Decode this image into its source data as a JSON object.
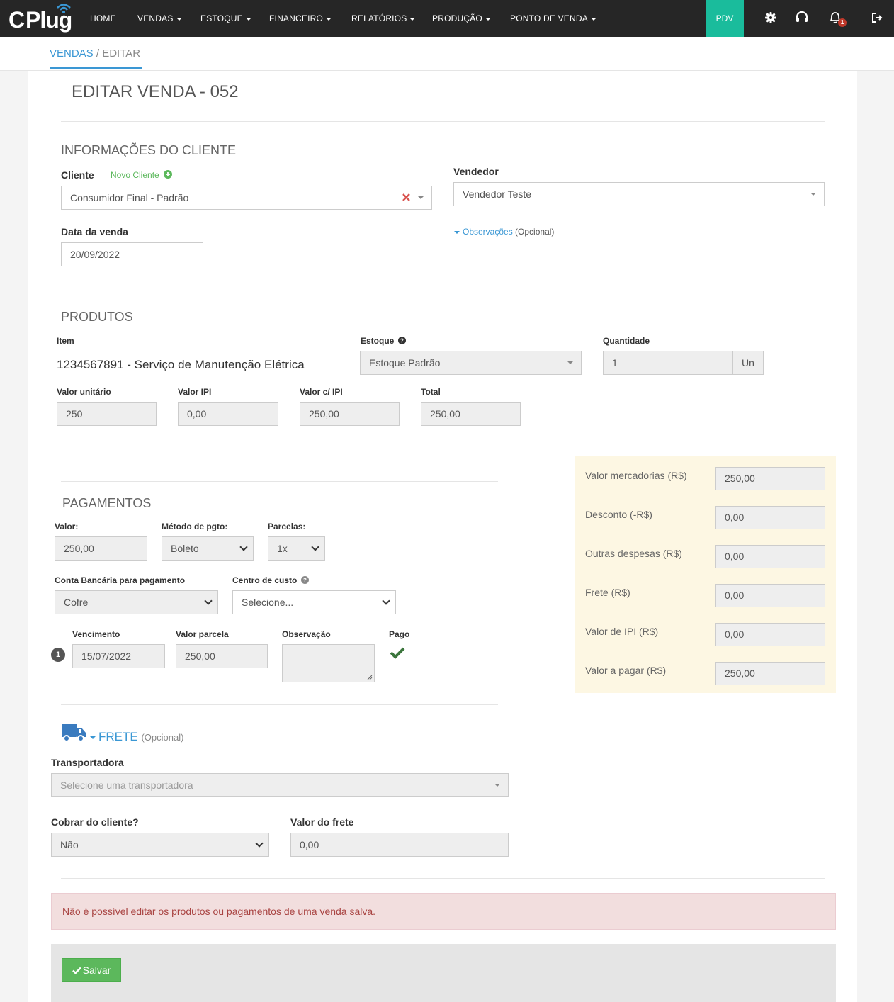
{
  "nav": {
    "logo_c": "C",
    "logo_plug": "Plug",
    "items": [
      "HOME",
      "VENDAS",
      "ESTOQUE",
      "FINANCEIRO",
      "RELATÓRIOS",
      "PRODUÇÃO",
      "PONTO DE VENDA"
    ],
    "pdv": "PDV",
    "notification_count": "1"
  },
  "breadcrumb": {
    "section": "VENDAS",
    "separator": " / ",
    "page": "EDITAR"
  },
  "page_title": "EDITAR VENDA - 052",
  "cliente_section": {
    "title": "INFORMAÇÕES DO CLIENTE",
    "cliente_label": "Cliente",
    "novo_cliente": "Novo Cliente",
    "cliente_value": "Consumidor Final - Padrão",
    "vendedor_label": "Vendedor",
    "vendedor_value": "Vendedor Teste",
    "data_label": "Data da venda",
    "data_value": "20/09/2022",
    "observacoes_link": "Observações",
    "observacoes_opcional": "(Opcional)"
  },
  "produtos": {
    "title": "PRODUTOS",
    "item_label": "Item",
    "item_value": "1234567891 - Serviço de Manutenção Elétrica",
    "estoque_label": "Estoque",
    "estoque_value": "Estoque Padrão",
    "quantidade_label": "Quantidade",
    "quantidade_value": "1",
    "unidade": "Un",
    "valor_unitario_label": "Valor unitário",
    "valor_unitario": "250",
    "valor_ipi_label": "Valor IPI",
    "valor_ipi": "0,00",
    "valor_com_ipi_label": "Valor c/ IPI",
    "valor_com_ipi": "250,00",
    "total_label": "Total",
    "total": "250,00"
  },
  "pagamentos": {
    "title": "PAGAMENTOS",
    "valor_label": "Valor:",
    "valor": "250,00",
    "metodo_label": "Método de pgto:",
    "metodo": "Boleto",
    "parcelas_label": "Parcelas:",
    "parcelas": "1x",
    "conta_label": "Conta Bancária para pagamento",
    "conta": "Cofre",
    "centro_label": "Centro de custo",
    "centro": "Selecione...",
    "vencimento_label": "Vencimento",
    "valor_parcela_label": "Valor parcela",
    "observacao_label": "Observação",
    "pago_label": "Pago",
    "parcela_num": "1",
    "vencimento": "15/07/2022",
    "valor_parcela": "250,00"
  },
  "summary": [
    {
      "label": "Valor mercadorias (R$)",
      "value": "250,00"
    },
    {
      "label": "Desconto (-R$)",
      "value": "0,00"
    },
    {
      "label": "Outras despesas (R$)",
      "value": "0,00"
    },
    {
      "label": "Frete (R$)",
      "value": "0,00"
    },
    {
      "label": "Valor de IPI (R$)",
      "value": "0,00"
    },
    {
      "label": "Valor a pagar (R$)",
      "value": "250,00"
    }
  ],
  "frete": {
    "title": "FRETE",
    "opcional": "(Opcional)",
    "transportadora_label": "Transportadora",
    "transportadora_placeholder": "Selecione uma transportadora",
    "cobrar_label": "Cobrar do cliente?",
    "cobrar_value": "Não",
    "valor_frete_label": "Valor do frete",
    "valor_frete": "0,00"
  },
  "alert": "Não é possível editar os produtos ou pagamentos de uma venda salva.",
  "save_button": "Salvar",
  "colors": {
    "topbar": "#262626",
    "pdv": "#1abc9c",
    "link": "#3a97d4",
    "success": "#5cb85c",
    "summary_bg": "#fdf7e3",
    "alert_bg": "#f2dede"
  }
}
